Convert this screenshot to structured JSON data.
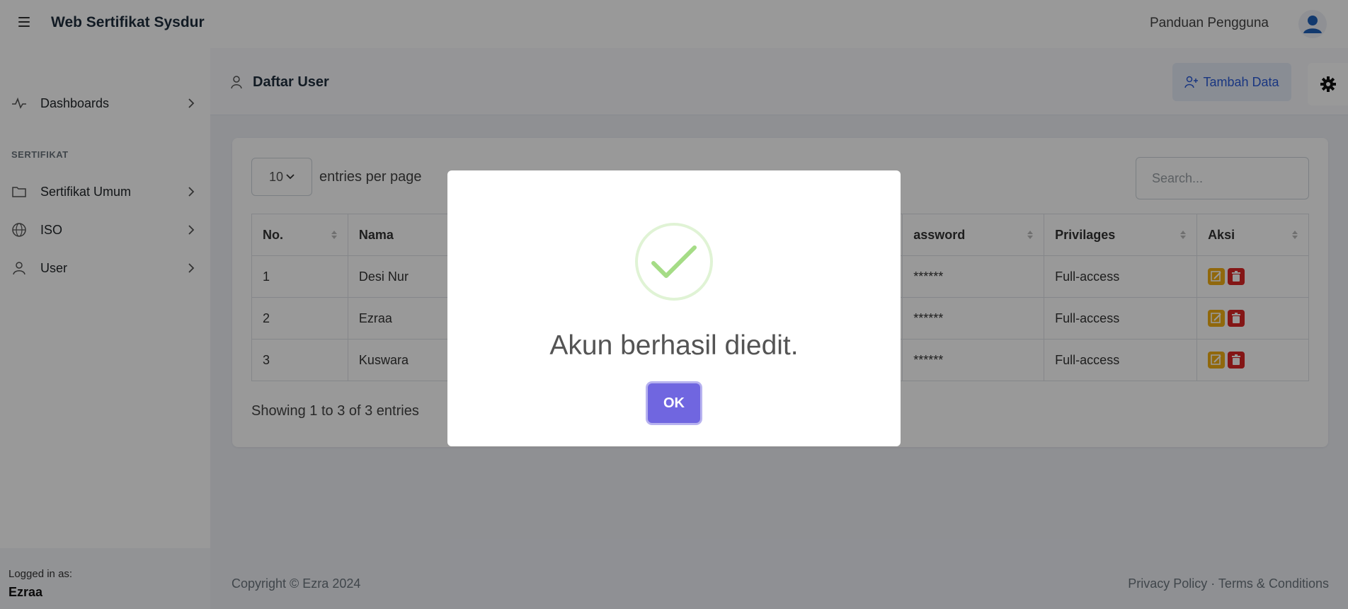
{
  "app": {
    "title": "Web Sertifikat Sysdur"
  },
  "topbar": {
    "guide_link": "Panduan Pengguna"
  },
  "sidebar": {
    "items": [
      {
        "label": "Dashboards",
        "icon": "activity-icon"
      },
      {
        "label": "Sertifikat Umum",
        "icon": "folder-icon"
      },
      {
        "label": "ISO",
        "icon": "globe-icon"
      },
      {
        "label": "User",
        "icon": "user-icon"
      }
    ],
    "section_heading": "SERTIFIKAT",
    "footer": {
      "logged_in_label": "Logged in as:",
      "username": "Ezraa"
    }
  },
  "page": {
    "title": "Daftar User",
    "add_button": "Tambah Data"
  },
  "table": {
    "per_page_value": "10",
    "per_page_label": "entries per page",
    "search_placeholder": "Search...",
    "columns": [
      "No.",
      "Nama",
      "assword",
      "Privilages",
      "Aksi"
    ],
    "rows": [
      {
        "no": "1",
        "nama": "Desi Nur",
        "password": "******",
        "privilages": "Full-access"
      },
      {
        "no": "2",
        "nama": "Ezraa",
        "password": "******",
        "privilages": "Full-access"
      },
      {
        "no": "3",
        "nama": "Kuswara",
        "password": "******",
        "privilages": "Full-access"
      }
    ],
    "showing": "Showing 1 to 3 of 3 entries"
  },
  "footer": {
    "copyright": "Copyright © Ezra 2024",
    "links": "Privacy Policy · Terms & Conditions"
  },
  "modal": {
    "message": "Akun berhasil diedit.",
    "ok_label": "OK",
    "icon": "success-check-icon"
  },
  "colors": {
    "accent": "#7066e0",
    "success": "#a5dc86",
    "edit": "#f0ad14",
    "delete": "#dc2626",
    "link": "#2b5bd7"
  }
}
